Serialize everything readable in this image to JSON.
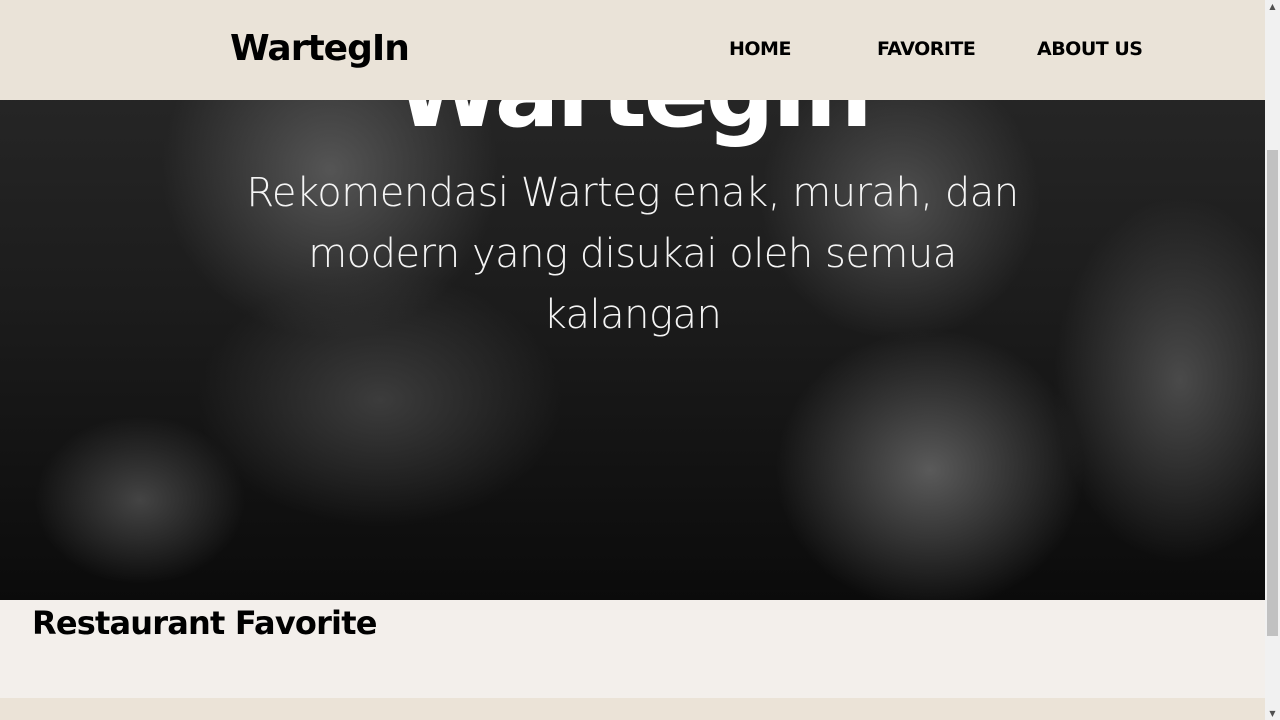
{
  "header": {
    "logo": "WartegIn",
    "nav": [
      {
        "label": "HOME"
      },
      {
        "label": "FAVORITE"
      },
      {
        "label": "ABOUT US"
      }
    ]
  },
  "hero": {
    "title": "WartegIn",
    "subtitle": "Rekomendasi Warteg enak, murah, dan modern yang disukai oleh semua kalangan"
  },
  "section": {
    "title": "Restaurant Favorite"
  },
  "colors": {
    "header_bg": "#eae3d8",
    "page_bg": "#f3efeb"
  }
}
